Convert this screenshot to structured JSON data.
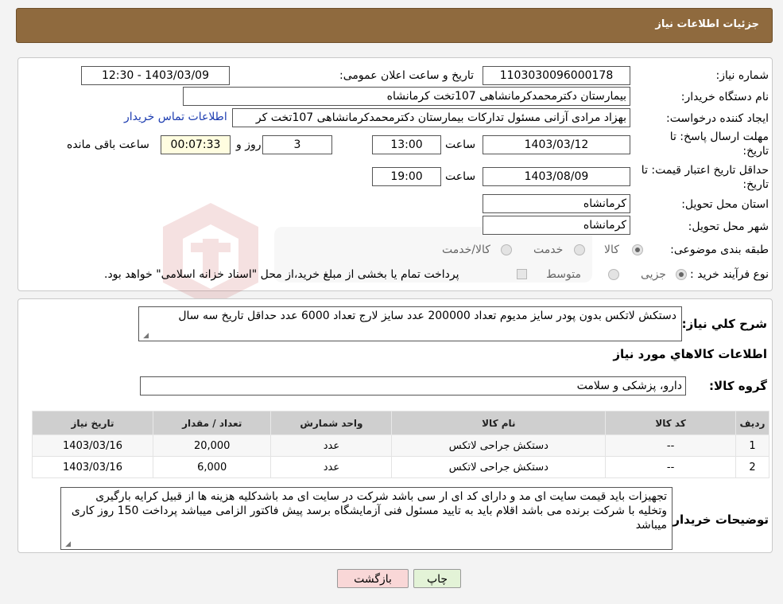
{
  "header": {
    "title": "جزئیات اطلاعات نیاز"
  },
  "need_info": {
    "need_number_label": "شماره نیاز:",
    "need_number": "1103030096000178",
    "announce_label": "تاریخ و ساعت اعلان عمومی:",
    "announce_value": "1403/03/09 - 12:30",
    "buyer_org_label": "نام دستگاه خریدار:",
    "buyer_org": "بیمارستان دکترمحمدکرمانشاهی 107تخت کرمانشاه",
    "requester_label": "ایجاد کننده درخواست:",
    "requester": "بهزاد مرادی آزانی مسئول تداركات بیمارستان دكترمحمدكرمانشاهی 107تخت كر",
    "contact_link": "اطلاعات تماس خریدار",
    "deadline_label_1": "مهلت ارسال پاسخ: تا",
    "deadline_label_2": "تاریخ:",
    "deadline_date": "1403/03/12",
    "time_label": "ساعت",
    "deadline_time": "13:00",
    "days_value": "3",
    "days_label": "روز و",
    "remaining_value": "00:07:33",
    "remaining_label": "ساعت باقی مانده",
    "validity_label_1": "حداقل تاریخ اعتبار قیمت: تا",
    "validity_label_2": "تاریخ:",
    "validity_date": "1403/08/09",
    "validity_time": "19:00",
    "province_label": "استان محل تحویل:",
    "province": "کرمانشاه",
    "city_label": "شهر محل تحویل:",
    "city": "کرمانشاه",
    "category_label": "طبقه بندی موضوعی:",
    "category_options": [
      "کالا",
      "خدمت",
      "کالا/خدمت"
    ],
    "process_label": "نوع فرآیند خرید :",
    "process_options": [
      "جزیی",
      "متوسط"
    ],
    "process_note": "پرداخت تمام یا بخشی از مبلغ خرید،از محل \"اسناد خزانه اسلامی\" خواهد بود."
  },
  "description": {
    "label": "شرح كلي نياز:",
    "text": "دستکش لاتکس بدون پودر سایز مدیوم تعداد 200000 عدد سایز لارج تعداد 6000 عدد حداقل تاریخ سه سال"
  },
  "items_section": {
    "title": "اطلاعات كالاهاي مورد نياز",
    "group_label": "گروه كالا:",
    "group_value": "دارو، پزشکی و سلامت",
    "columns": [
      "ردیف",
      "کد کالا",
      "نام کالا",
      "واحد شمارش",
      "تعداد / مقدار",
      "تاریخ نیاز"
    ],
    "rows": [
      {
        "row": "1",
        "code": "--",
        "name": "دستکش جراحی لاتکس",
        "unit": "عدد",
        "qty": "20,000",
        "date": "1403/03/16"
      },
      {
        "row": "2",
        "code": "--",
        "name": "دستکش جراحی لاتکس",
        "unit": "عدد",
        "qty": "6,000",
        "date": "1403/03/16"
      }
    ]
  },
  "buyer_notes": {
    "label": "توضیحات خریدار:",
    "text": "تجهیزات باید قیمت سایت ای مد و دارای کد ای ار سی باشد شرکت در سایت ای مد باشدکلیه هزینه ها از قبیل کرایه بارگیری وتخلیه با شرکت برنده می باشد اقلام باید به تایید مسئول فنی آزمایشگاه برسد پیش فاکتور الزامی میباشد پرداخت 150 روز کاری میباشد"
  },
  "buttons": {
    "print": "چاپ",
    "back": "بازگشت"
  },
  "colors": {
    "header": "#8f6a3e",
    "back_button": "#f9d7d7",
    "print_button": "#e3f3d7",
    "link": "#1b3bb0"
  }
}
